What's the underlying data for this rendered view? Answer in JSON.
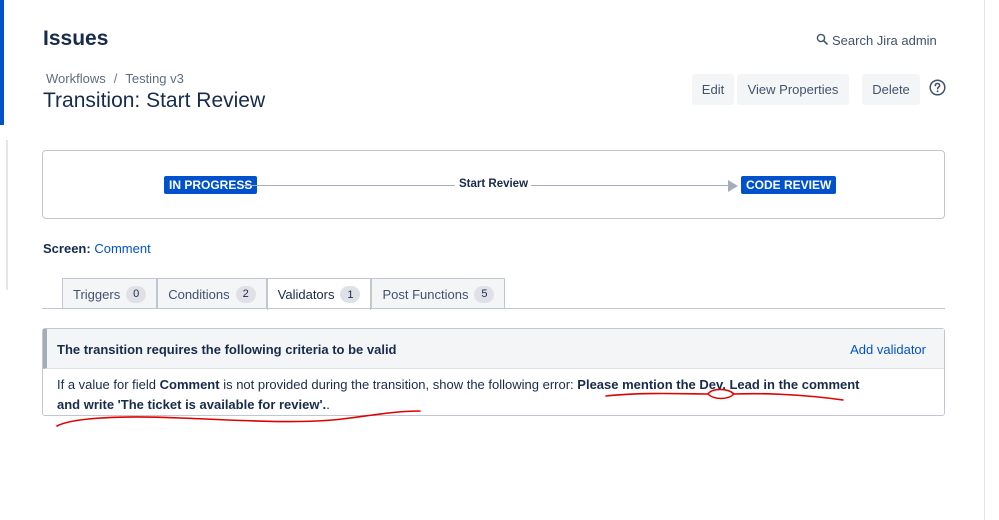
{
  "header": {
    "title": "Issues",
    "search_label": "Search Jira admin"
  },
  "breadcrumb": {
    "items": [
      "Workflows",
      "Testing v3"
    ],
    "separator": "/"
  },
  "transition": {
    "title": "Transition: Start Review"
  },
  "toolbar": {
    "edit_label": "Edit",
    "view_properties_label": "View Properties",
    "delete_label": "Delete",
    "help_icon": "question-circle-icon"
  },
  "diagram": {
    "from_status": "IN PROGRESS",
    "transition_name": "Start Review",
    "to_status": "CODE REVIEW",
    "status_color": "#0052cc"
  },
  "screen": {
    "label": "Screen:",
    "value": "Comment"
  },
  "tabs": [
    {
      "label": "Triggers",
      "count": "0",
      "active": false
    },
    {
      "label": "Conditions",
      "count": "2",
      "active": false
    },
    {
      "label": "Validators",
      "count": "1",
      "active": true
    },
    {
      "label": "Post Functions",
      "count": "5",
      "active": false
    }
  ],
  "validator": {
    "heading": "The transition requires the following criteria to be valid",
    "add_label": "Add validator",
    "text_prefix": "If a value for field ",
    "field_name": "Comment",
    "text_middle": " is not provided during the transition, show the following error: ",
    "error_message": "Please mention the Dev. Lead in the comment and write 'The ticket is available for review'.",
    "text_suffix": "."
  },
  "colors": {
    "accent": "#0052cc",
    "annotation": "#e00000"
  }
}
